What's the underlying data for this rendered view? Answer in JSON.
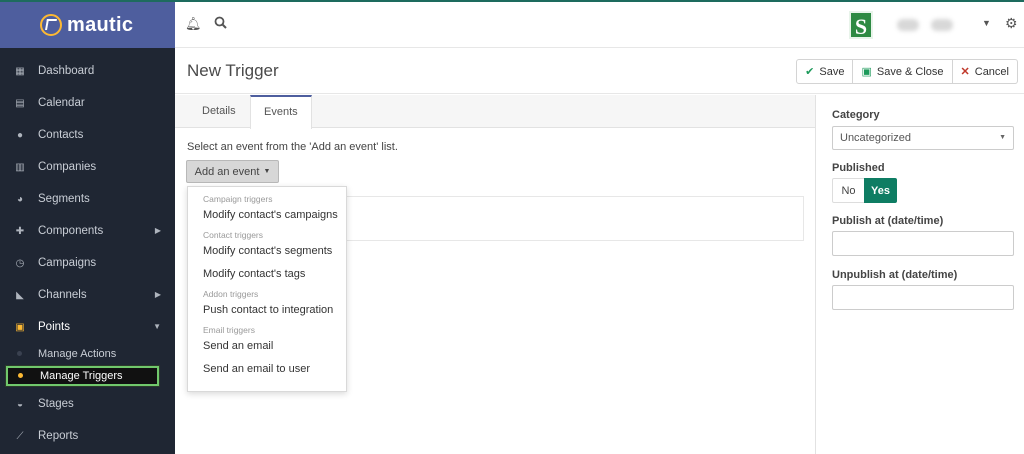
{
  "brand": {
    "name": "mautic"
  },
  "sidebar": {
    "items": [
      {
        "label": "Dashboard",
        "icon": "dashboard-icon"
      },
      {
        "label": "Calendar",
        "icon": "calendar-icon"
      },
      {
        "label": "Contacts",
        "icon": "user-icon"
      },
      {
        "label": "Companies",
        "icon": "building-icon"
      },
      {
        "label": "Segments",
        "icon": "pie-chart-icon"
      },
      {
        "label": "Components",
        "icon": "puzzle-icon"
      },
      {
        "label": "Campaigns",
        "icon": "clock-icon"
      },
      {
        "label": "Channels",
        "icon": "rss-icon"
      },
      {
        "label": "Points",
        "icon": "calculator-icon"
      },
      {
        "label": "Stages",
        "icon": "tachometer-icon"
      },
      {
        "label": "Reports",
        "icon": "line-chart-icon"
      }
    ],
    "points_sub": [
      {
        "label": "Manage Actions"
      },
      {
        "label": "Manage Triggers"
      }
    ]
  },
  "topbar": {
    "avatar_letter": "S"
  },
  "header": {
    "title": "New Trigger",
    "save": "Save",
    "save_close": "Save & Close",
    "cancel": "Cancel"
  },
  "tabs": [
    {
      "label": "Details"
    },
    {
      "label": "Events"
    }
  ],
  "events": {
    "hint": "Select an event from the 'Add an event' list.",
    "add_button": "Add an event",
    "groups": [
      {
        "header": "Campaign triggers",
        "items": [
          "Modify contact's campaigns"
        ]
      },
      {
        "header": "Contact triggers",
        "items": [
          "Modify contact's segments",
          "Modify contact's tags"
        ]
      },
      {
        "header": "Addon triggers",
        "items": [
          "Push contact to integration"
        ]
      },
      {
        "header": "Email triggers",
        "items": [
          "Send an email",
          "Send an email to user"
        ]
      }
    ]
  },
  "right": {
    "category_label": "Category",
    "category_value": "Uncategorized",
    "published_label": "Published",
    "no": "No",
    "yes": "Yes",
    "publish_at_label": "Publish at (date/time)",
    "unpublish_at_label": "Unpublish at (date/time)"
  },
  "colors": {
    "brand": "#4e5e9e",
    "sidebar": "#1f2633",
    "accent": "#fdb933",
    "yes": "#0e7d63"
  }
}
